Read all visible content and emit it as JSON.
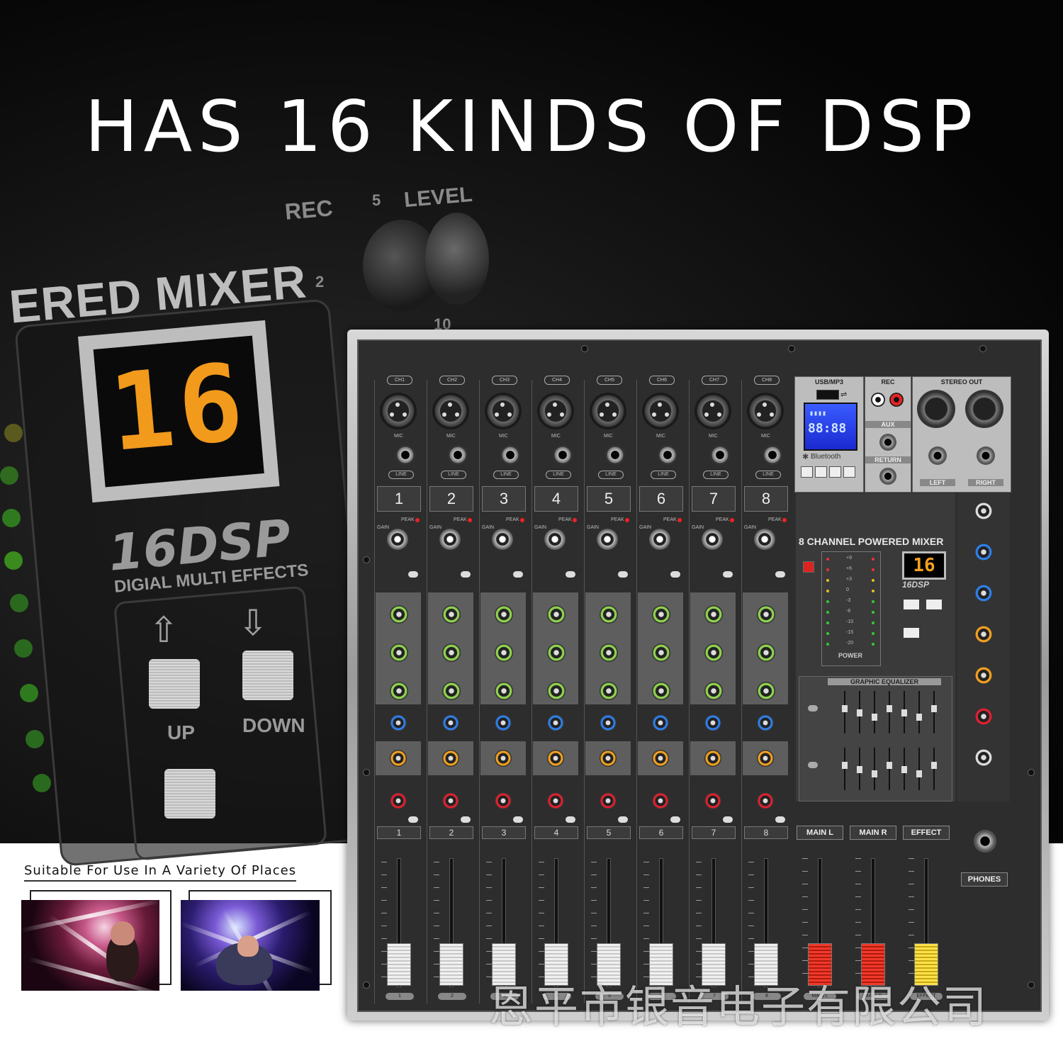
{
  "headline": "HAS 16 KINDS OF DSP",
  "closeup": {
    "title": "ERED MIXER",
    "rec": "REC",
    "level": "LEVEL",
    "scale_5": "5",
    "scale_2": "2",
    "scale_10": "10",
    "display_value": "16",
    "dsp_logo": "16DSP",
    "effects_label": "DIGIAL MULTI EFFECTS",
    "up_label": "UP",
    "down_label": "DOWN"
  },
  "places": {
    "title": "Suitable For Use In A Variety Of Places"
  },
  "mixer": {
    "channels": [
      "1",
      "2",
      "3",
      "4",
      "5",
      "6",
      "7",
      "8"
    ],
    "mic_label": "MIC",
    "line_label": "LINE",
    "peak_label": "PEAK",
    "gain_label": "GAIN",
    "usb_label": "USB/MP3",
    "rec_label": "REC",
    "stereo_out_label": "STEREO OUT",
    "aux_label": "AUX",
    "return_label": "RETURN",
    "left_label": "LEFT",
    "right_label": "RIGHT",
    "bluetooth_label": "Bluetooth",
    "master_title": "8 CHANNEL POWERED MIXER",
    "dsp_display": "16",
    "power_label": "POWER",
    "geq_label": "GRAPHIC EQUALIZER",
    "main_l": "MAIN L",
    "main_r": "MAIN R",
    "effect": "EFFECT",
    "phones": "PHONES",
    "meter_scale": [
      "+9",
      "+6",
      "+3",
      "0",
      "-3",
      "-6",
      "-10",
      "-15",
      "-20"
    ]
  },
  "watermark": "恩平市银音电子有限公司"
}
